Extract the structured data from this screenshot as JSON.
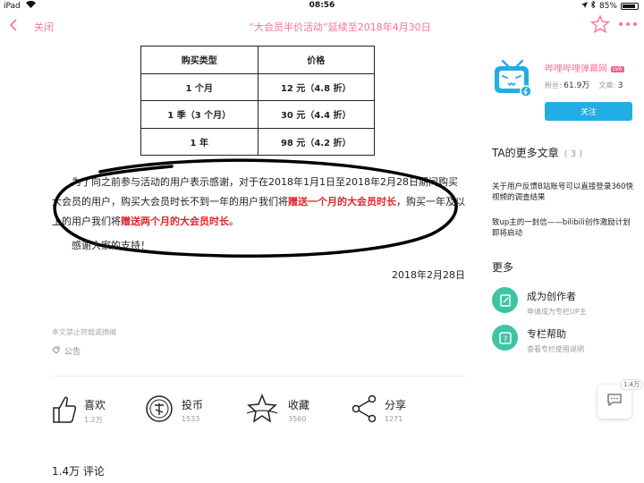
{
  "status_bar": {
    "device": "iPad",
    "time": "08:56",
    "battery": "85%",
    "battery_level": 0.85
  },
  "nav": {
    "close_label": "关闭",
    "title": "“大会员半价活动”延续至2018年4月30日"
  },
  "price_table": {
    "headers": [
      "购买类型",
      "价格"
    ],
    "rows": [
      [
        "1 个月",
        "12 元（4.8 折）"
      ],
      [
        "1 季（3 个月）",
        "30 元（4.4 折）"
      ],
      [
        "1 年",
        "98 元（4.2 折）"
      ]
    ]
  },
  "article": {
    "p1_a": "为了向之前参与活动的用户表示感谢，对于在2018年1月1日至2018年2月28日期间购买大会员的用户，购买大会员时长不到一年的用户我们将",
    "p1_hl1": "赠送一个月的大会员时长",
    "p1_b": "，购买一年及以上的用户我们将",
    "p1_hl2": "赠送两个月的大会员时长",
    "p1_c": "。",
    "thanks": "感谢大家的支持！",
    "date": "2018年2月28日",
    "copyright": "本文禁止转载或摘编",
    "tag": "公告"
  },
  "actions": [
    {
      "label": "喜欢",
      "count": "1.2万"
    },
    {
      "label": "投币",
      "count": "1533"
    },
    {
      "label": "收藏",
      "count": "3560"
    },
    {
      "label": "分享",
      "count": "1271"
    }
  ],
  "comments": {
    "title": "1.4万 评论"
  },
  "sidebar": {
    "author_name": "哔哩哔哩弹幕网",
    "lv_badge": "LV6",
    "fans_label": "粉丝:",
    "fans": "61.9万",
    "articles_label": "文章:",
    "articles": "3",
    "follow_label": "关注",
    "more_articles_title": "TA的更多文章",
    "more_articles_count": "( 3 )",
    "links": [
      "关于用户反馈B站账号可以直接登录360快视频的调查结果",
      "致up主的一封信——bilibili创作激励计划即将启动"
    ],
    "more_title": "更多",
    "items": [
      {
        "title": "成为创作者",
        "desc": "申请成为专栏UP主"
      },
      {
        "title": "专栏帮助",
        "desc": "查看专栏使用说明"
      }
    ]
  },
  "float": {
    "badge": "1.4万"
  },
  "colors": {
    "accent": "#fb7299",
    "follow": "#23ade5",
    "highlight": "#e0262b",
    "green": "#3fc3a5"
  }
}
